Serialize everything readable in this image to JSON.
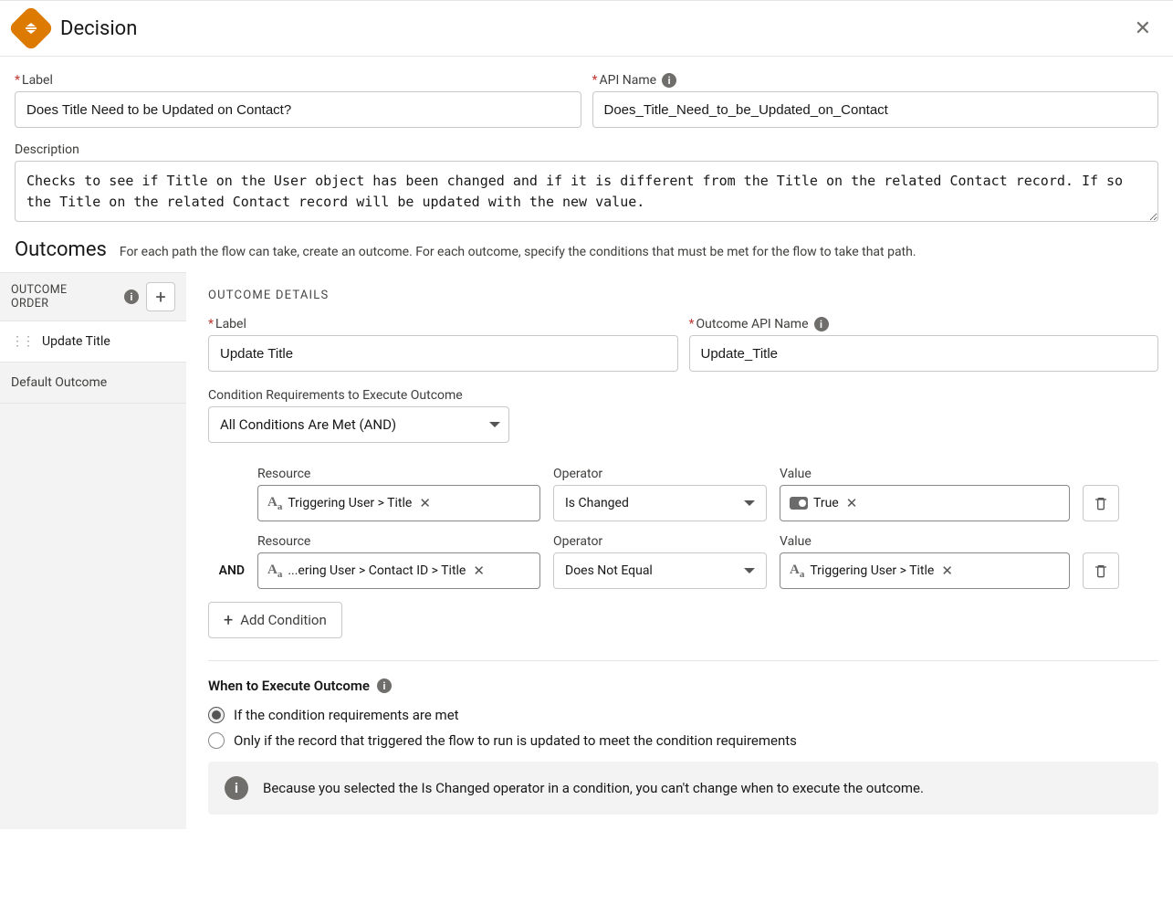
{
  "header": {
    "title": "Decision"
  },
  "fields": {
    "label_label": "Label",
    "label_value": "Does Title Need to be Updated on Contact?",
    "api_label": "API Name",
    "api_value": "Does_Title_Need_to_be_Updated_on_Contact",
    "description_label": "Description",
    "description_value": "Checks to see if Title on the User object has been changed and if it is different from the Title on the related Contact record. If so the Title on the related Contact record will be updated with the new value."
  },
  "outcomes": {
    "title": "Outcomes",
    "hint": "For each path the flow can take, create an outcome. For each outcome, specify the conditions that must be met for the flow to take that path.",
    "order_title": "OUTCOME ORDER",
    "items": [
      "Update Title"
    ],
    "default_label": "Default Outcome"
  },
  "details": {
    "heading": "OUTCOME DETAILS",
    "label_label": "Label",
    "label_value": "Update Title",
    "api_label": "Outcome API Name",
    "api_value": "Update_Title",
    "cond_req_label": "Condition Requirements to Execute Outcome",
    "cond_req_value": "All Conditions Are Met (AND)",
    "resource_col": "Resource",
    "operator_col": "Operator",
    "value_col": "Value",
    "and_label": "AND",
    "conditions": [
      {
        "resource": "Triggering User > Title",
        "operator": "Is Changed",
        "value_type": "bool",
        "value": "True"
      },
      {
        "resource": "...ering User > Contact ID > Title",
        "operator": "Does Not Equal",
        "value_type": "resource",
        "value": "Triggering User > Title"
      }
    ],
    "add_condition": "Add Condition"
  },
  "exec": {
    "heading": "When to Execute Outcome",
    "opt1": "If the condition requirements are met",
    "opt2": "Only if the record that triggered the flow to run is updated to meet the condition requirements",
    "selected": 0,
    "banner": "Because you selected the Is Changed operator in a condition, you can't change when to execute the outcome."
  }
}
